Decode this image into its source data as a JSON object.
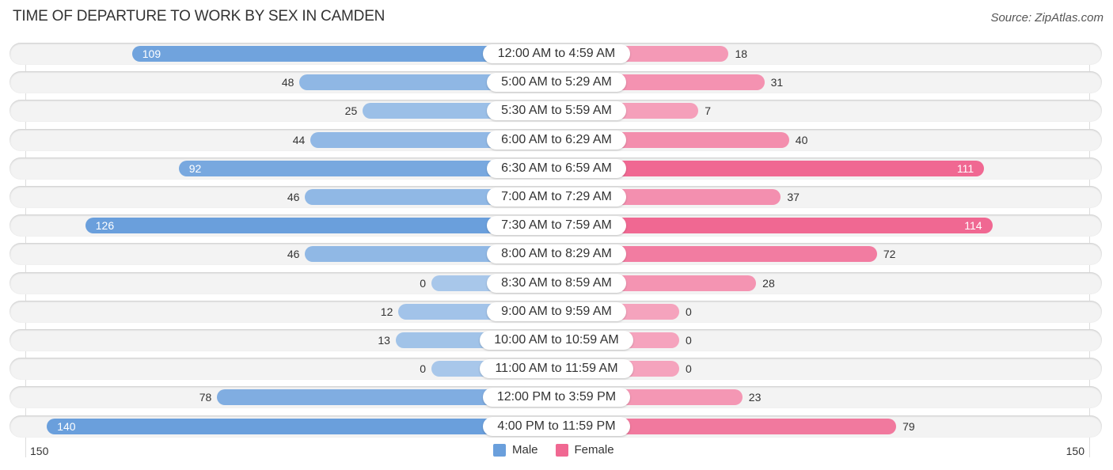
{
  "chart_data": {
    "type": "bar",
    "orientation": "horizontal-diverging",
    "title": "TIME OF DEPARTURE TO WORK BY SEX IN CAMDEN",
    "source": "Source: ZipAtlas.com",
    "categories": [
      "12:00 AM to 4:59 AM",
      "5:00 AM to 5:29 AM",
      "5:30 AM to 5:59 AM",
      "6:00 AM to 6:29 AM",
      "6:30 AM to 6:59 AM",
      "7:00 AM to 7:29 AM",
      "7:30 AM to 7:59 AM",
      "8:00 AM to 8:29 AM",
      "8:30 AM to 8:59 AM",
      "9:00 AM to 9:59 AM",
      "10:00 AM to 10:59 AM",
      "11:00 AM to 11:59 AM",
      "12:00 PM to 3:59 PM",
      "4:00 PM to 11:59 PM"
    ],
    "series": [
      {
        "name": "Male",
        "color": "#6a9fdc",
        "values": [
          109,
          48,
          25,
          44,
          92,
          46,
          126,
          46,
          0,
          12,
          13,
          0,
          78,
          140
        ]
      },
      {
        "name": "Female",
        "color": "#f06892",
        "values": [
          18,
          31,
          7,
          40,
          111,
          37,
          114,
          72,
          28,
          0,
          0,
          0,
          23,
          79
        ]
      }
    ],
    "axis": {
      "left_label": "150",
      "right_label": "150",
      "range": [
        0,
        150
      ]
    },
    "legend": {
      "position": "bottom-center",
      "items": [
        "Male",
        "Female"
      ]
    }
  }
}
